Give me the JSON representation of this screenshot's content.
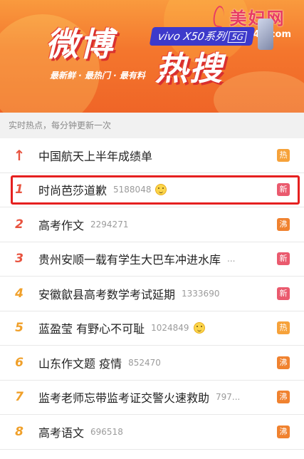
{
  "banner": {
    "watermark_logo": "美妇网",
    "watermark_url": "meifu43.com",
    "title_part1": "微博",
    "title_part2": "热搜",
    "vivo_label": "vivo X50系列",
    "vivo_5g": "5G",
    "slogan": "最新鲜 · 最热门 · 最有料"
  },
  "subtitle": "实时热点，每分钟更新一次",
  "badge_colors": {
    "热": "#f6a23a",
    "新": "#ea5a6e",
    "沸": "#f0822f"
  },
  "items": [
    {
      "rank": "↑",
      "title": "中国航天上半年成绩单",
      "count": "",
      "emoji": false,
      "badge": "热",
      "badge_color": "#f6a23a",
      "highlight": false,
      "rank_class": "top"
    },
    {
      "rank": "1",
      "title": "时尚芭莎道歉",
      "count": "5188048",
      "emoji": true,
      "badge": "新",
      "badge_color": "#ea5a6e",
      "highlight": true,
      "rank_class": "red"
    },
    {
      "rank": "2",
      "title": "高考作文",
      "count": "2294271",
      "emoji": false,
      "badge": "沸",
      "badge_color": "#f0822f",
      "highlight": false,
      "rank_class": "red"
    },
    {
      "rank": "3",
      "title": "贵州安顺一载有学生大巴车冲进水库",
      "count": "...",
      "emoji": false,
      "badge": "新",
      "badge_color": "#ea5a6e",
      "highlight": false,
      "rank_class": "red"
    },
    {
      "rank": "4",
      "title": "安徽歙县高考数学考试延期",
      "count": "1333690",
      "emoji": false,
      "badge": "新",
      "badge_color": "#ea5a6e",
      "highlight": false,
      "rank_class": ""
    },
    {
      "rank": "5",
      "title": "蓝盈莹 有野心不可耻",
      "count": "1024849",
      "emoji": true,
      "badge": "热",
      "badge_color": "#f6a23a",
      "highlight": false,
      "rank_class": ""
    },
    {
      "rank": "6",
      "title": "山东作文题 疫情",
      "count": "852470",
      "emoji": false,
      "badge": "沸",
      "badge_color": "#f0822f",
      "highlight": false,
      "rank_class": ""
    },
    {
      "rank": "7",
      "title": "监考老师忘带监考证交警火速救助",
      "count": "797...",
      "emoji": false,
      "badge": "沸",
      "badge_color": "#f0822f",
      "highlight": false,
      "rank_class": ""
    },
    {
      "rank": "8",
      "title": "高考语文",
      "count": "696518",
      "emoji": false,
      "badge": "沸",
      "badge_color": "#f0822f",
      "highlight": false,
      "rank_class": ""
    }
  ]
}
